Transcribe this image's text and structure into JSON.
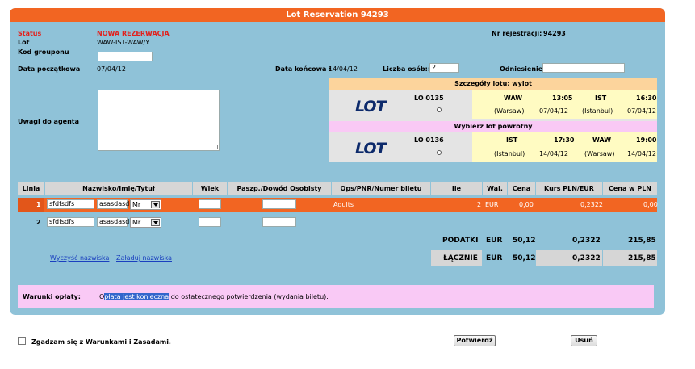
{
  "title": "Lot Reservation 94293",
  "info": {
    "status_label": "Status",
    "status_value": "NOWA REZERWACJA",
    "lot_label": "Lot",
    "lot_value": "WAW-IST-WAW/Y",
    "group_label": "Kod grouponu",
    "start_label": "Data początkowa",
    "start_value": "07/04/12",
    "end_label": "Data końcowa :",
    "end_value": "14/04/12",
    "persons_label": "Liczba osób::",
    "persons_value": "2",
    "reference_label": "Odniesienie:",
    "regnr_label": "Nr rejestracji:",
    "regnr_value": "94293",
    "notes_label": "Uwagi do agenta"
  },
  "flights": {
    "outbound_header": "Szczegóły lotu: wylot",
    "return_header": "Wybierz lot powrotny",
    "logo_text": "LOT",
    "outbound": {
      "code": "LO 0135",
      "from": "WAW",
      "from_time": "13:05",
      "from_city": "(Warsaw)",
      "from_date": "07/04/12",
      "to": "IST",
      "to_time": "16:30",
      "to_city": "(Istanbul)",
      "to_date": "07/04/12"
    },
    "return": {
      "code": "LO 0136",
      "from": "IST",
      "from_time": "17:30",
      "from_city": "(Istanbul)",
      "from_date": "14/04/12",
      "to": "WAW",
      "to_time": "19:00",
      "to_city": "(Warsaw)",
      "to_date": "14/04/12"
    }
  },
  "table": {
    "headers": [
      "Linia",
      "Nazwisko/Imię/Tytuł",
      "Wiek",
      "Paszp./Dowód Osobisty",
      "Ops/PNR/Numer biletu",
      "Ile",
      "Wal.",
      "Cena",
      "Kurs PLN/EUR",
      "Cena w PLN"
    ],
    "rows": [
      {
        "line": "1",
        "surname": "sfdfsdfs",
        "name": "asasdasd",
        "title": "Mr",
        "ops": "Adults",
        "qty": "2",
        "cur": "EUR",
        "price": "0,00",
        "rate": "0,2322",
        "pln": "0,00"
      },
      {
        "line": "2",
        "surname": "sfdfsdfs",
        "name": "asasdasd",
        "title": "Mr"
      }
    ]
  },
  "summary": {
    "tax_label": "PODATKI",
    "tax_cur": "EUR",
    "tax_price": "50,12",
    "tax_rate": "0,2322",
    "tax_pln": "215,85",
    "total_label": "ŁĄCZNIE",
    "total_cur": "EUR",
    "total_price": "50,12",
    "total_rate": "0,2322",
    "total_pln": "215,85"
  },
  "links": {
    "clear_names": "Wyczyść nazwiska",
    "load_names": "Załaduj nazwiska"
  },
  "payment": {
    "label": "Warunki opłaty:",
    "text_pre": "O",
    "text_highlight": "płata jest konieczna",
    "text_post": " do ostatecznego potwierdzenia (wydania biletu)."
  },
  "footer": {
    "agree_label": "Zgadzam się z Warunkami i Zasadami.",
    "confirm_button": "Potwierdź",
    "delete_button": "Usuń"
  },
  "colors": {
    "accent": "#f26522",
    "panel": "#8fc2d8",
    "flight_header_out": "#fcd49c",
    "flight_header_ret": "#f9c9f5",
    "payment_bg": "#f9c9f5",
    "status_red": "#e2211c"
  }
}
